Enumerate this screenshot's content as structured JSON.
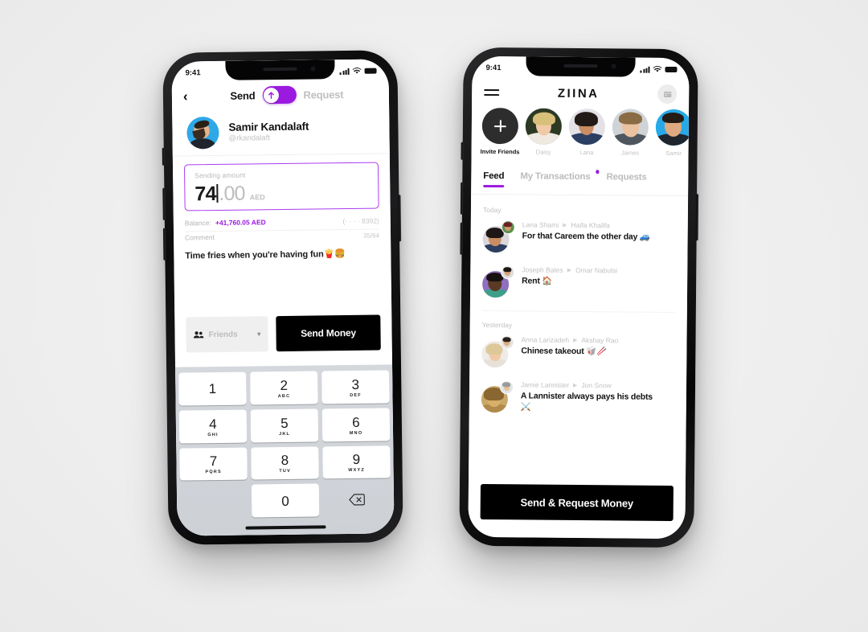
{
  "background_color": "#f1f1f1",
  "accent_purple": "#9b1ae0",
  "left_phone": {
    "status_bar": {
      "time": "9:41"
    },
    "nav": {
      "back_icon": "chevron-left-icon",
      "send_label": "Send",
      "request_label": "Request",
      "toggle_state": "send",
      "toggle_icon": "arrow-up-icon"
    },
    "recipient": {
      "name": "Samir Kandalaft",
      "handle": "@rkandalaft"
    },
    "amount": {
      "label": "Sending amount",
      "integer": "74",
      "decimal": ".00",
      "currency": "AED"
    },
    "balance": {
      "label": "Balance:",
      "value": "+41,760.05 AED",
      "card": "(· · · · 8392)"
    },
    "comment": {
      "label": "Comment",
      "counter": "35/64",
      "text": "Time fries when you're having fun🍟🍔"
    },
    "actions": {
      "audience_label": "Friends",
      "audience_icon": "people-icon",
      "chevron_icon": "chevron-down-icon",
      "send_label": "Send Money"
    },
    "keypad": {
      "keys": [
        {
          "num": "1",
          "sub": ""
        },
        {
          "num": "2",
          "sub": "ABC"
        },
        {
          "num": "3",
          "sub": "DEF"
        },
        {
          "num": "4",
          "sub": "GHI"
        },
        {
          "num": "5",
          "sub": "JKL"
        },
        {
          "num": "6",
          "sub": "MNO"
        },
        {
          "num": "7",
          "sub": "PQRS"
        },
        {
          "num": "8",
          "sub": "TUV"
        },
        {
          "num": "9",
          "sub": "WXYZ"
        },
        {
          "num": "0",
          "sub": ""
        }
      ],
      "delete_icon": "backspace-icon"
    }
  },
  "right_phone": {
    "status_bar": {
      "time": "9:41"
    },
    "header": {
      "menu_icon": "hamburger-menu-icon",
      "title": "ZIINA",
      "wallet_icon": "wallet-card-icon"
    },
    "stories": [
      {
        "name": "Invite Friends",
        "type": "invite",
        "icon": "plus-icon"
      },
      {
        "name": "Daisy",
        "type": "avatar"
      },
      {
        "name": "Lana",
        "type": "avatar"
      },
      {
        "name": "James",
        "type": "avatar"
      },
      {
        "name": "Samir",
        "type": "avatar"
      }
    ],
    "tabs": [
      {
        "label": "Feed",
        "active": true,
        "dot": false
      },
      {
        "label": "My Transactions",
        "active": false,
        "dot": true
      },
      {
        "label": "Requests",
        "active": false,
        "dot": false
      }
    ],
    "feed": [
      {
        "day": "Today",
        "items": [
          {
            "from": "Lana Shami",
            "to": "Haifa Khalifa",
            "text": "For that Careem the other day 🚙"
          },
          {
            "from": "Joseph Bates",
            "to": "Omar Nabulsi",
            "text": "Rent 🏠"
          }
        ]
      },
      {
        "day": "Yesterday",
        "items": [
          {
            "from": "Anna Larizadeh",
            "to": "Akshay Rao",
            "text": "Chinese takeout 🥡🥢"
          },
          {
            "from": "Jamie Lannister",
            "to": "Jon Snow",
            "text": "A Lannister always pays his debts ⚔️"
          }
        ]
      }
    ],
    "cta": {
      "label": "Send & Request Money"
    }
  }
}
